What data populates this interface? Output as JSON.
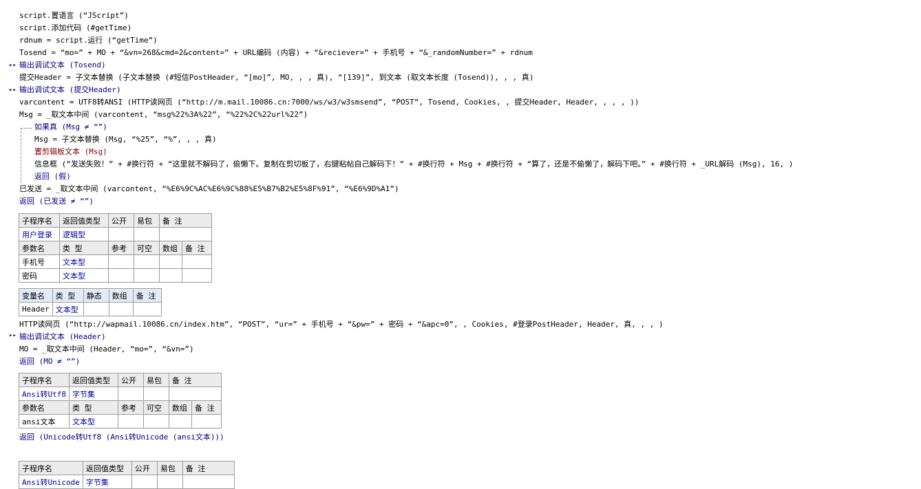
{
  "lines": [
    "script.置语言 (“JScript”)",
    "script.添加代码 (#getTime)",
    "rdnum = script.运行 (“getTime”)",
    "Tosend = “mo=” + MO + “&vn=268&cmd=2&content=” + URL编码 (内容) + “&reciever=” + 手机号 + “&_randomNumber=” + rdnum",
    "输出调试文本 (Tosend)",
    "提交Header = 子文本替换 (子文本替换 (#短信PostHeader, “[mo]”, MO, , , 真), “[139]”, 到文本 (取文本长度 (Tosend)), , , 真)",
    "输出调试文本 (提交Header)",
    "varcontent = UTF8转ANSI (HTTP读网页 (“http://m.mail.10086.cn:7000/ws/w3/w3smsend”, “POST”, Tosend, Cookies, , 提交Header, Header, , , , ))",
    "Msg = _取文本中间 (varcontent, “msg%22%3A%22”, “%22%2C%22url%22”)",
    "如果真 (Msg ≠ “”)",
    "Msg = 子文本替换 (Msg, “%25”, “%”, , , 真)",
    "置剪辑板文本 (Msg)",
    "信息框 (“发送失败！” + #换行符 + “这里就不解码了，偷懒下。复制在剪切板了，右键粘帖自己解码下！” + #换行符 + Msg + #换行符 + “算了，还是不偷懒了，解码下吧。” + #换行符 + _URL解码 (Msg), 16, )",
    "返回 (假)",
    "已发送 = _取文本中间 (varcontent, “%E6%9C%AC%E6%9C%88%E5%B7%B2%E5%8F%91”, “%E6%9D%A1”)",
    "返回 (已发送 ≠ “”)",
    "HTTP读网页 (“http://wapmail.10086.cn/index.htm”, “POST”, “ur=” + 手机号 + “&pw=” + 密码 + “&apc=0”, , Cookies, #登录PostHeader, Header, 真, , , )",
    "输出调试文本 (Header)",
    "MO = _取文本中间 (Header, “mo=”, “&vn=”)",
    "返回 (MO ≠ “”)",
    "返回 (Unicode转Utf8 (Ansi转Unicode (ansi文本)))"
  ],
  "table1": {
    "sub_header": [
      "子程序名",
      "返回值类型",
      "公开",
      "易包",
      "备 注"
    ],
    "sub_row": [
      "用户登录",
      "逻辑型",
      "",
      "",
      ""
    ],
    "param_header": [
      "参数名",
      "类 型",
      "参考",
      "可空",
      "数组",
      "备 注"
    ],
    "params": [
      [
        "手机号",
        "文本型",
        "",
        "",
        "",
        ""
      ],
      [
        "密码",
        "文本型",
        "",
        "",
        "",
        ""
      ]
    ]
  },
  "vars": {
    "header": [
      "变量名",
      "类 型",
      "静态",
      "数组",
      "备 注"
    ],
    "rows": [
      [
        "Header",
        "文本型",
        "",
        "",
        ""
      ]
    ]
  },
  "table2": {
    "sub_header": [
      "子程序名",
      "返回值类型",
      "公开",
      "易包",
      "备 注"
    ],
    "sub_row": [
      "Ansi转Utf8",
      "字节集",
      "",
      "",
      ""
    ],
    "param_header": [
      "参数名",
      "类 型",
      "参考",
      "可空",
      "数组",
      "备 注"
    ],
    "params": [
      [
        "ansi文本",
        "文本型",
        "",
        "",
        "",
        ""
      ]
    ]
  },
  "table3": {
    "sub_header": [
      "子程序名",
      "返回值类型",
      "公开",
      "易包",
      "备 注"
    ],
    "sub_row": [
      "Ansi转Unicode",
      "字节集",
      "",
      "",
      ""
    ]
  },
  "colors": {
    "keyword": "#000080",
    "function": "#800000",
    "string": "#006666",
    "type": "#0000a0",
    "grid": "#9b9b9b"
  }
}
